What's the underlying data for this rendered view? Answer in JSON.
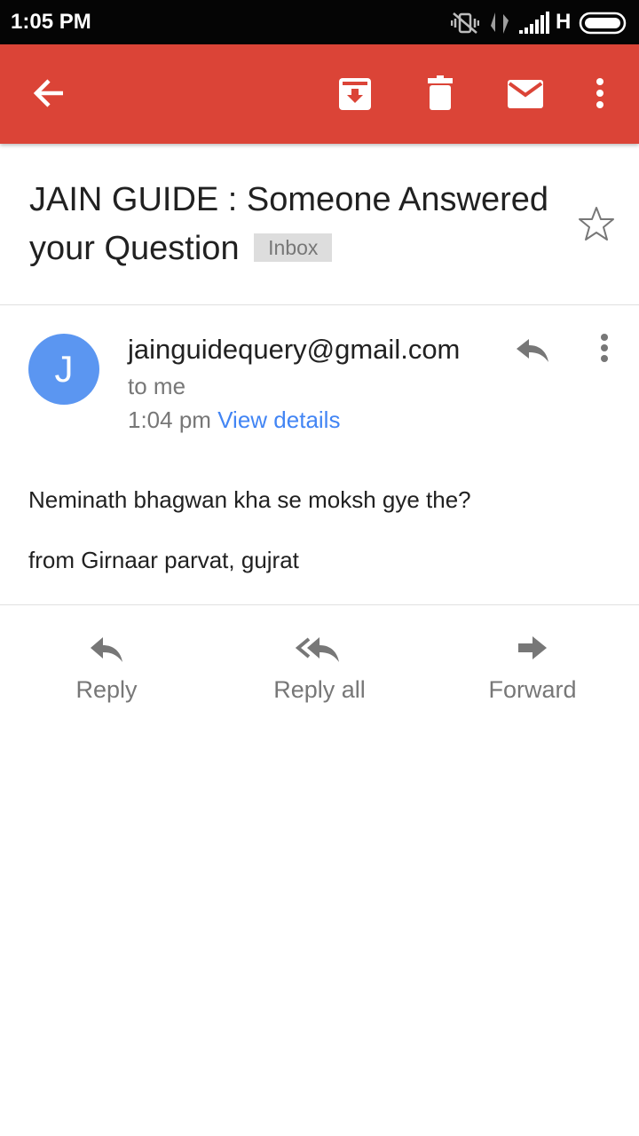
{
  "status_bar": {
    "time": "1:05 PM",
    "network_type": "H",
    "icons": [
      "vibrate-off-icon",
      "data-transfer-icon",
      "signal-icon",
      "battery-icon"
    ]
  },
  "app_bar": {
    "color": "#db4437",
    "actions": [
      "back-arrow-icon",
      "archive-icon",
      "delete-icon",
      "mark-unread-icon",
      "more-vert-icon"
    ]
  },
  "email": {
    "subject": "JAIN GUIDE : Someone Answered your Question",
    "label": "Inbox",
    "starred": false,
    "sender": {
      "initial": "J",
      "address": "jainguidequery@gmail.com",
      "avatar_color": "#5b96f1"
    },
    "recipient": "to me",
    "time": "1:04 pm",
    "view_details": "View details",
    "body": [
      "Neminath bhagwan kha se moksh gye the?",
      "from Girnaar parvat, gujrat"
    ]
  },
  "actions": {
    "reply": "Reply",
    "reply_all": "Reply all",
    "forward": "Forward"
  }
}
